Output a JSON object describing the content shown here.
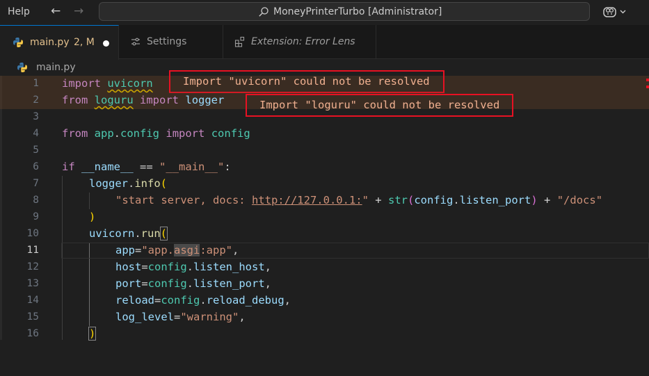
{
  "menu": {
    "help": "Help"
  },
  "titlebar": {
    "title": "MoneyPrinterTurbo [Administrator]"
  },
  "tabs": [
    {
      "label": "main.py",
      "status": "2, M"
    },
    {
      "label": "Settings"
    },
    {
      "label": "Extension: Error Lens"
    }
  ],
  "breadcrumb": {
    "file": "main.py"
  },
  "editor": {
    "line_numbers": [
      "1",
      "2",
      "3",
      "4",
      "5",
      "6",
      "7",
      "8",
      "9",
      "10",
      "11",
      "12",
      "13",
      "14",
      "15",
      "16"
    ],
    "errors": [
      "Import \"uvicorn\" could not be resolved",
      "Import \"loguru\" could not be resolved"
    ],
    "tokens": {
      "l1_import": "import",
      "l1_mod": "uvicorn",
      "l2_from": "from",
      "l2_mod": "loguru",
      "l2_import": "import",
      "l2_name": "logger",
      "l4_from": "from",
      "l4_mod1": "app",
      "l4_dot": ".",
      "l4_mod2": "config",
      "l4_import": "import",
      "l4_name": "config",
      "l6_if": "if",
      "l6_name": "__name__",
      "l6_eq": "==",
      "l6_str": "\"__main__\"",
      "l6_colon": ":",
      "l7_obj": "logger",
      "l7_dot": ".",
      "l7_fn": "info",
      "l7_paren": "(",
      "l8_str_a": "\"start server, docs: ",
      "l8_url": "http://127.0.0.1:",
      "l8_str_b": "\"",
      "l8_plus1": "+",
      "l8_fn": "str",
      "l8_p_open": "(",
      "l8_obj": "config",
      "l8_dot": ".",
      "l8_attr": "listen_port",
      "l8_p_close": ")",
      "l8_plus2": "+",
      "l8_str_c": "\"/docs\"",
      "l9_paren": ")",
      "l10_obj": "uvicorn",
      "l10_dot": ".",
      "l10_fn": "run",
      "l10_paren": "(",
      "l11_param": "app",
      "l11_eq": "=",
      "l11_str_a": "\"app.",
      "l11_str_b": "asgi",
      "l11_str_c": ":app\"",
      "l11_comma": ",",
      "l12_param": "host",
      "l12_eq": "=",
      "l12_obj": "config",
      "l12_dot": ".",
      "l12_attr": "listen_host",
      "l12_comma": ",",
      "l13_param": "port",
      "l13_eq": "=",
      "l13_obj": "config",
      "l13_dot": ".",
      "l13_attr": "listen_port",
      "l13_comma": ",",
      "l14_param": "reload",
      "l14_eq": "=",
      "l14_obj": "config",
      "l14_dot": ".",
      "l14_attr": "reload_debug",
      "l14_comma": ",",
      "l15_param": "log_level",
      "l15_eq": "=",
      "l15_str": "\"warning\"",
      "l15_comma": ",",
      "l16_paren": ")"
    }
  },
  "colors": {
    "background": "#1f1f1f",
    "error_box": "#e81123",
    "error_text": "#f0b090",
    "modified_tab": "#e2c08d",
    "accent": "#0078d4"
  },
  "icons": [
    "arrow-left-icon",
    "arrow-right-icon",
    "search-icon",
    "copilot-icon",
    "chevron-down-icon",
    "python-file-icon",
    "settings-sliders-icon",
    "extensions-icon",
    "close-dot-icon"
  ]
}
